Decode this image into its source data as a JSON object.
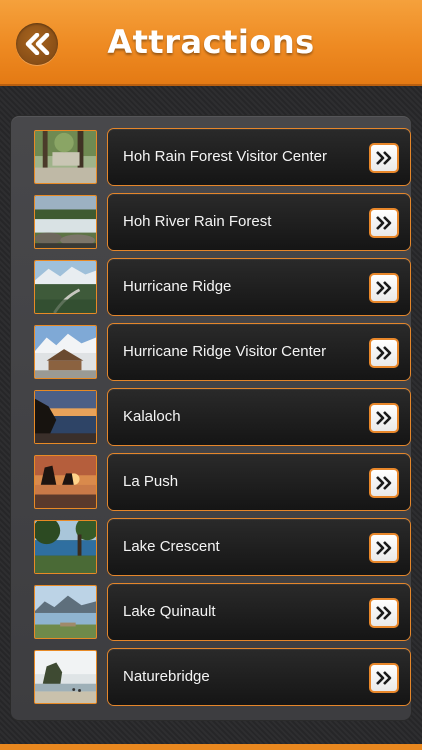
{
  "header": {
    "title": "Attractions",
    "back_icon": "double-chevron-left-icon"
  },
  "colors": {
    "header_orange": "#ee8a22",
    "accent_border": "#e5862a",
    "card_dark": "#1a1a1a",
    "text": "#f4f4f4"
  },
  "attractions": [
    {
      "label": "Hoh Rain Forest Visitor Center",
      "thumb": "forest-visitor-center"
    },
    {
      "label": "Hoh River Rain Forest",
      "thumb": "river-rocks"
    },
    {
      "label": "Hurricane Ridge",
      "thumb": "mountain-road"
    },
    {
      "label": "Hurricane Ridge Visitor Center",
      "thumb": "lodge-snow-mountains"
    },
    {
      "label": "Kalaloch",
      "thumb": "coast-sunset"
    },
    {
      "label": "La Push",
      "thumb": "sea-stacks-sunset"
    },
    {
      "label": "Lake Crescent",
      "thumb": "lake-tree"
    },
    {
      "label": "Lake Quinault",
      "thumb": "lake-mountains"
    },
    {
      "label": "Naturebridge",
      "thumb": "beach-rock"
    }
  ],
  "row_action_icon": "double-chevron-right-icon"
}
